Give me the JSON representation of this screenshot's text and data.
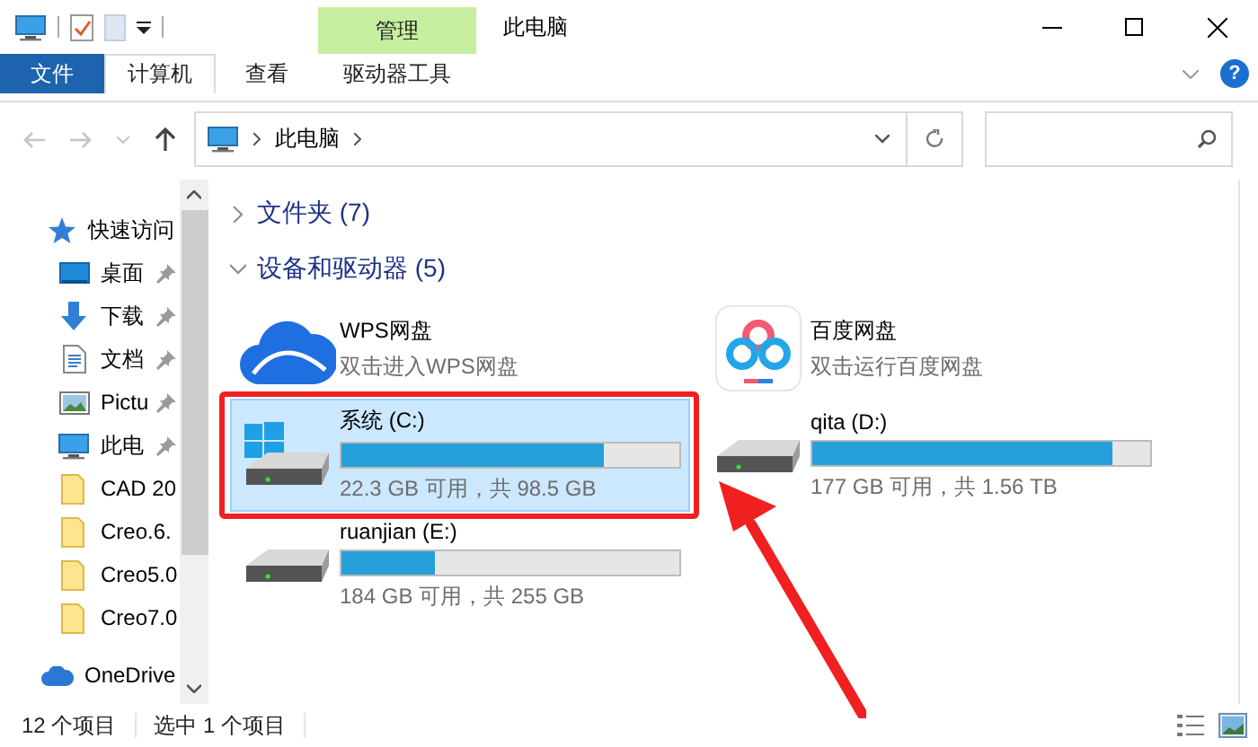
{
  "title_bar": {
    "context_group": "管理",
    "title": "此电脑"
  },
  "ribbon": {
    "tabs": [
      {
        "label": "文件",
        "kind": "file",
        "selected": false
      },
      {
        "label": "计算机",
        "kind": "tab",
        "selected": true
      },
      {
        "label": "查看",
        "kind": "tab",
        "selected": false
      },
      {
        "label": "驱动器工具",
        "kind": "context",
        "selected": false
      }
    ],
    "help": "?"
  },
  "address_bar": {
    "path": [
      "此电脑"
    ]
  },
  "sidebar": {
    "items": [
      {
        "label": "快速访问",
        "kind": "star",
        "pinned": false,
        "children": [
          {
            "label": "桌面",
            "kind": "desktop",
            "pinned": true
          },
          {
            "label": "下载",
            "kind": "download",
            "pinned": true
          },
          {
            "label": "文档",
            "kind": "document",
            "pinned": true
          },
          {
            "label": "Pictu",
            "kind": "pictures",
            "pinned": true
          },
          {
            "label": "此电",
            "kind": "computer",
            "pinned": true
          },
          {
            "label": "CAD 20",
            "kind": "folder",
            "pinned": false
          },
          {
            "label": "Creo.6.",
            "kind": "folder",
            "pinned": false
          },
          {
            "label": "Creo5.0",
            "kind": "folder",
            "pinned": false
          },
          {
            "label": "Creo7.0",
            "kind": "folder",
            "pinned": false
          }
        ]
      },
      {
        "label": "OneDrive",
        "kind": "cloud",
        "pinned": false
      }
    ]
  },
  "content": {
    "groups": [
      {
        "title": "文件夹 (7)",
        "expanded": false
      },
      {
        "title": "设备和驱动器 (5)",
        "expanded": true,
        "items": [
          {
            "kind": "cloud-app",
            "name": "WPS网盘",
            "detail": "双击进入WPS网盘",
            "selected": false
          },
          {
            "kind": "rings-app",
            "name": "百度网盘",
            "detail": "双击运行百度网盘",
            "selected": false
          },
          {
            "kind": "system-drive",
            "name": "系统 (C:)",
            "level": 0.774,
            "detail": "22.3 GB 可用，共 98.5 GB",
            "selected": true
          },
          {
            "kind": "drive",
            "name": "qita (D:)",
            "level": 0.887,
            "detail": "177 GB 可用，共 1.56 TB",
            "selected": false
          },
          {
            "kind": "drive",
            "name": "ruanjian (E:)",
            "level": 0.278,
            "detail": "184 GB 可用，共 255 GB",
            "selected": false
          }
        ]
      }
    ]
  },
  "status_bar": {
    "item_count": "12 个项目",
    "selection": "选中 1 个项目"
  }
}
